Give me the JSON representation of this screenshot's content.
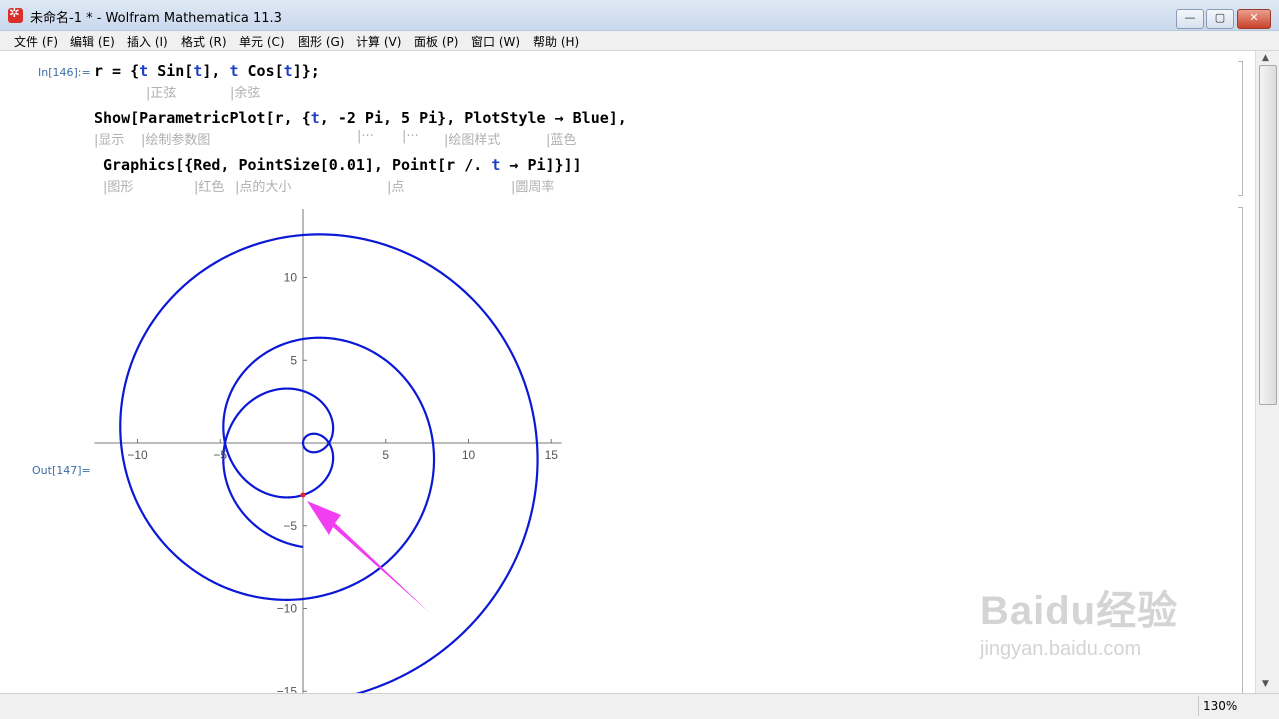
{
  "window": {
    "title": "未命名-1 * - Wolfram Mathematica 11.3",
    "minimize": "—",
    "maximize": "▢",
    "close": "✕"
  },
  "menu": [
    "文件 (F)",
    "编辑 (E)",
    "插入 (I)",
    "格式 (R)",
    "单元 (C)",
    "图形 (G)",
    "计算 (V)",
    "面板 (P)",
    "窗口 (W)",
    "帮助 (H)"
  ],
  "cell_in": {
    "label": "In[146]:=",
    "line1": {
      "a": "r = {",
      "t1": "t",
      "b": " Sin[",
      "t2": "t",
      "c": "], ",
      "t3": "t",
      "d": " Cos[",
      "t4": "t",
      "e": "]};"
    },
    "hints1": {
      "sin": "|正弦",
      "cos": "|余弦"
    },
    "line2": {
      "a": "Show[ParametricPlot[r, {",
      "t": "t",
      "b": ", -2 Pi, 5 Pi}, PlotStyle → Blue],"
    },
    "hints2": {
      "show": "|显示",
      "pplot": "|绘制参数图",
      "e1": "|···",
      "e2": "|···",
      "style": "|绘图样式",
      "blue": "|蓝色"
    },
    "line3": {
      "a": "Graphics[{Red, PointSize[0.01], Point[r /. ",
      "t": "t",
      "b": " → Pi]}]]"
    },
    "hints3": {
      "graphics": "|图形",
      "red": "|红色",
      "psize": "|点的大小",
      "point": "|点",
      "pi": "|圆周率"
    }
  },
  "cell_out": {
    "label": "Out[147]="
  },
  "chart_data": {
    "type": "line",
    "description_expr": "r = {t Sin[t], t Cos[t]}, t from -2Pi to 5Pi",
    "series": [
      {
        "name": "",
        "function": "x = t sin t, y = t cos t",
        "t_range": [
          -6.2832,
          15.708
        ],
        "color": "#0b18d6"
      }
    ],
    "point": {
      "x": 0,
      "y": -3.1416,
      "color": "#e8202a"
    },
    "xlim": [
      -12.3,
      15.5
    ],
    "ylim": [
      -15,
      14.2
    ],
    "xticks": [
      -10,
      -5,
      5,
      10,
      15
    ],
    "yticks": [
      -15,
      -10,
      -5,
      5,
      10
    ],
    "x_tick_labels": [
      "−10",
      "−5",
      "5",
      "10",
      "15"
    ],
    "y_tick_labels": [
      "−15",
      "−10",
      "−5",
      "5",
      "10"
    ],
    "annotation_arrow": {
      "color": "#f03ef0",
      "points_to": {
        "x": 0,
        "y": -3.1416
      }
    }
  },
  "status": {
    "zoom": "130%"
  },
  "watermark": {
    "brand": "Baidu经验",
    "url": "jingyan.baidu.com"
  }
}
